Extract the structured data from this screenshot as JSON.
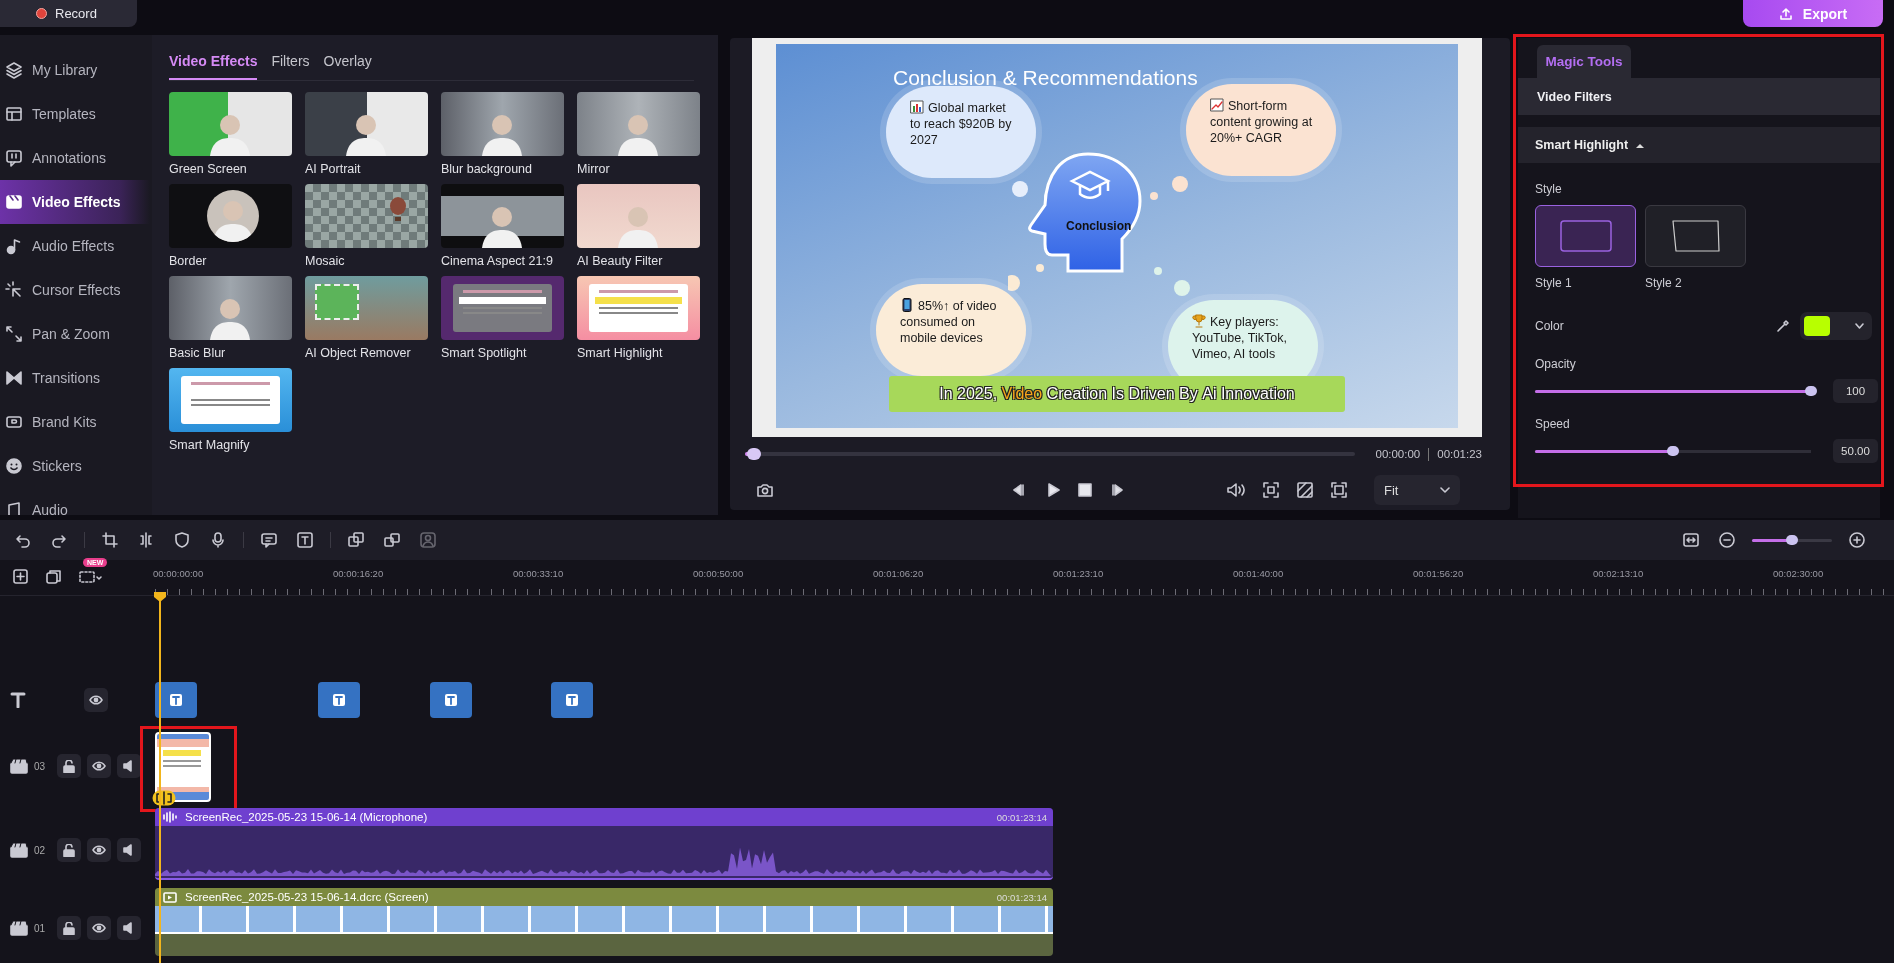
{
  "top_bar": {
    "record_label": "Record",
    "export_label": "Export"
  },
  "sidebar": {
    "items": [
      {
        "label": "My Library",
        "selected": false
      },
      {
        "label": "Templates",
        "selected": false
      },
      {
        "label": "Annotations",
        "selected": false
      },
      {
        "label": "Video Effects",
        "selected": true
      },
      {
        "label": "Audio Effects",
        "selected": false
      },
      {
        "label": "Cursor Effects",
        "selected": false
      },
      {
        "label": "Pan & Zoom",
        "selected": false
      },
      {
        "label": "Transitions",
        "selected": false
      },
      {
        "label": "Brand Kits",
        "selected": false
      },
      {
        "label": "Stickers",
        "selected": false
      },
      {
        "label": "Audio",
        "selected": false
      }
    ]
  },
  "effects_panel": {
    "tabs": [
      {
        "label": "Video Effects",
        "selected": true
      },
      {
        "label": "Filters",
        "selected": false
      },
      {
        "label": "Overlay",
        "selected": false
      }
    ],
    "effects": [
      {
        "label": "Green Screen",
        "kind": "green"
      },
      {
        "label": "AI Portrait",
        "kind": "portrait"
      },
      {
        "label": "Blur background",
        "kind": "blur"
      },
      {
        "label": "Mirror",
        "kind": "mirror"
      },
      {
        "label": "Border",
        "kind": "border"
      },
      {
        "label": "Mosaic",
        "kind": "mosaic"
      },
      {
        "label": "Cinema Aspect 21:9",
        "kind": "cinema"
      },
      {
        "label": "AI Beauty Filter",
        "kind": "beauty"
      },
      {
        "label": "Basic Blur",
        "kind": "blur"
      },
      {
        "label": "AI Object Remover",
        "kind": "remover"
      },
      {
        "label": "Smart Spotlight",
        "kind": "spotlight"
      },
      {
        "label": "Smart Highlight",
        "kind": "highlight"
      },
      {
        "label": "Smart Magnify",
        "kind": "magnify"
      }
    ]
  },
  "preview": {
    "slide": {
      "title": "Conclusion & Recommendations",
      "clouds": [
        {
          "kind": "chart",
          "text": "Global market to reach $920B by 2027",
          "color": "#dde9fb"
        },
        {
          "kind": "trend",
          "text": "Short-form content growing at 20%+ CAGR",
          "color": "#fbe3d2"
        },
        {
          "kind": "phone",
          "text": "85%↑ of video consumed on mobile devices",
          "color": "#fbecd8"
        },
        {
          "kind": "trophy",
          "text": "Key players: YouTube, TikTok, Vimeo, AI tools",
          "color": "#ddf3ec"
        }
      ],
      "center": "Conclusion",
      "caption": [
        {
          "text": "In 2025, ",
          "highlight": false
        },
        {
          "text": "Video",
          "highlight": true
        },
        {
          "text": " Creation Is Driven By Ai Innovation",
          "highlight": false
        }
      ]
    },
    "progress": {
      "level": 0.01
    },
    "current_time": "00:00:00",
    "total_time": "00:01:23",
    "fit": "Fit"
  },
  "properties": {
    "tabs": [
      {
        "label": "Magic Tools",
        "selected": true
      }
    ],
    "section": "Video Filters",
    "group": {
      "title": "Smart Highlight",
      "expanded": true
    },
    "style_label": "Style",
    "styles": [
      {
        "label": "Style 1",
        "selected": true
      },
      {
        "label": "Style 2",
        "selected": false
      }
    ],
    "color": {
      "label": "Color",
      "color": "#b8ff00"
    },
    "sliders": [
      {
        "label": "Opacity",
        "level": 1,
        "value": "100"
      },
      {
        "label": "Speed",
        "level": 0.5,
        "value": "50.00"
      }
    ]
  },
  "timeline": {
    "new_badge": "NEW",
    "zoom": {
      "level": 0.5
    },
    "ruler": [
      "00:00:00:00",
      "00:00:16:20",
      "00:00:33:10",
      "00:00:50:00",
      "00:01:06:20",
      "00:01:23:10",
      "00:01:40:00",
      "00:01:56:20",
      "00:02:13:10",
      "00:02:30:00"
    ],
    "tracks": [
      {
        "kind": "text"
      },
      {
        "kind": "overlay",
        "number": "03"
      },
      {
        "kind": "audio",
        "number": "02",
        "clip": {
          "name": "ScreenRec_2025-05-23 15-06-14 (Microphone)",
          "duration": "00:01:23:14"
        }
      },
      {
        "kind": "video",
        "number": "01",
        "clip": {
          "name": "ScreenRec_2025-05-23 15-06-14.dcrc (Screen)",
          "duration": "00:01:23:14"
        }
      }
    ]
  }
}
